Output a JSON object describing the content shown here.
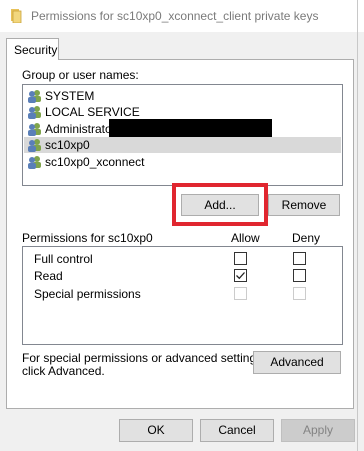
{
  "window": {
    "title": "Permissions for sc10xp0_xconnect_client private keys"
  },
  "tabs": [
    {
      "label": "Security"
    }
  ],
  "groups": {
    "label": "Group or user names:",
    "users": [
      {
        "name": "SYSTEM",
        "selected": false
      },
      {
        "name": "LOCAL SERVICE",
        "selected": false
      },
      {
        "name": "Administrator",
        "selected": false,
        "redacted": true
      },
      {
        "name": "sc10xp0",
        "selected": true
      },
      {
        "name": "sc10xp0_xconnect",
        "selected": false
      }
    ]
  },
  "buttons": {
    "add": "Add...",
    "remove": "Remove",
    "advanced": "Advanced",
    "ok": "OK",
    "cancel": "Cancel",
    "apply": "Apply"
  },
  "permissions": {
    "header": "Permissions for sc10xp0",
    "allow_header": "Allow",
    "deny_header": "Deny",
    "rows": [
      {
        "name": "Full control",
        "allow": false,
        "deny": false,
        "enabled": true
      },
      {
        "name": "Read",
        "allow": true,
        "deny": false,
        "enabled": true
      },
      {
        "name": "Special permissions",
        "allow": false,
        "deny": false,
        "enabled": false
      }
    ]
  },
  "advanced_note": {
    "line1": "For special permissions or advanced settings,",
    "line2": "click Advanced."
  },
  "colors": {
    "highlight": "#e0262f",
    "selection": "#d9d9d9"
  }
}
